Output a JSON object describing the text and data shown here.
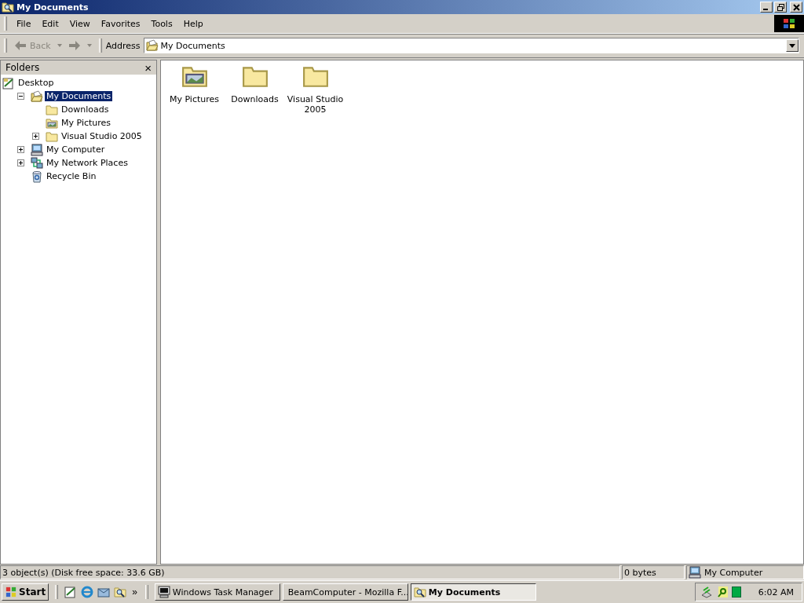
{
  "window": {
    "title": "My Documents"
  },
  "menu": [
    "File",
    "Edit",
    "View",
    "Favorites",
    "Tools",
    "Help"
  ],
  "toolbar": {
    "back": {
      "label": "Back",
      "disabled": true
    },
    "forward": {
      "disabled": true
    },
    "address_label": "Address",
    "address": "My Documents"
  },
  "folders_pane": {
    "title": "Folders",
    "close": "×",
    "tree": [
      {
        "label": "Desktop",
        "kind": "desktop",
        "selected": false,
        "children": [
          {
            "label": "My Documents",
            "kind": "documents",
            "selected": true,
            "expanded": true,
            "children": [
              {
                "label": "Downloads",
                "kind": "folder",
                "selected": false
              },
              {
                "label": "My Pictures",
                "kind": "pictures",
                "selected": false
              },
              {
                "label": "Visual Studio 2005",
                "kind": "folder",
                "selected": false,
                "expanded": false
              }
            ]
          },
          {
            "label": "My Computer",
            "kind": "computer",
            "selected": false,
            "expanded": false
          },
          {
            "label": "My Network Places",
            "kind": "network",
            "selected": false,
            "expanded": false
          },
          {
            "label": "Recycle Bin",
            "kind": "recycle",
            "selected": false
          }
        ]
      }
    ]
  },
  "files": [
    {
      "name": "My Pictures",
      "kind": "pictures"
    },
    {
      "name": "Downloads",
      "kind": "folder"
    },
    {
      "name": "Visual Studio 2005",
      "kind": "folder"
    }
  ],
  "status_bar": {
    "objects": "3 object(s) (Disk free space: 33.6 GB)",
    "size": "0 bytes",
    "zone": "My Computer"
  },
  "taskbar": {
    "start": "Start",
    "more": "»",
    "tasks": [
      {
        "label": "Windows Task Manager",
        "kind": "taskmgr",
        "selected": false
      },
      {
        "label": "BeamComputer - Mozilla F...",
        "kind": "browser",
        "selected": false
      },
      {
        "label": "My Documents",
        "kind": "explorer",
        "selected": true
      }
    ],
    "clock": "6:02 AM"
  }
}
